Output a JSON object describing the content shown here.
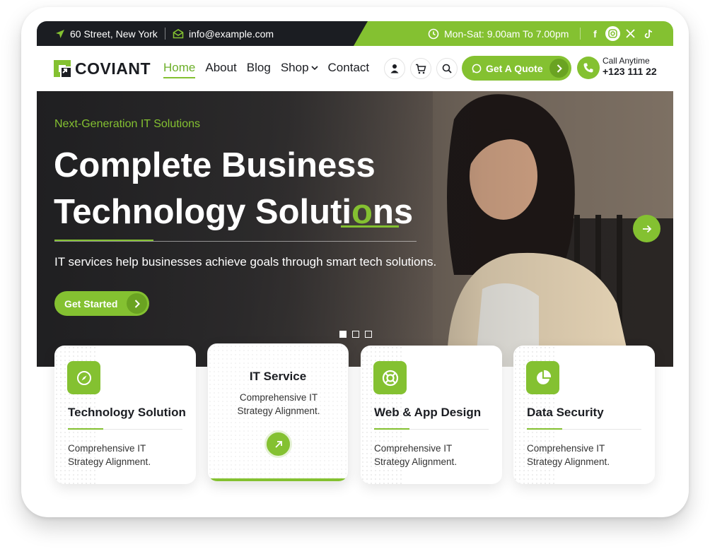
{
  "topbar": {
    "address": "60 Street, New York",
    "email": "info@example.com",
    "hours": "Mon-Sat: 9.00am To 7.00pm",
    "socials": [
      "facebook-icon",
      "instagram-icon",
      "x-icon",
      "tiktok-icon"
    ]
  },
  "header": {
    "logo_text": "COVIANT",
    "nav": [
      "Home",
      "About",
      "Blog",
      "Shop",
      "Contact"
    ],
    "quote_label": "Get A Quote",
    "call_label": "Call Anytime",
    "call_number": "+123 111 22"
  },
  "hero": {
    "eyebrow": "Next-Generation IT Solutions",
    "title_line1": "Complete Business",
    "title_line2_a": "Technology Solut",
    "title_line2_b": "i",
    "title_line2_c": "o",
    "title_line2_d": "ns",
    "description": "IT services help businesses achieve goals through smart tech solutions.",
    "button_label": "Get Started",
    "slides": 3,
    "active_slide": 1
  },
  "cards": [
    {
      "title": "Technology Solution",
      "desc": "Comprehensive IT Strategy Alignment.",
      "icon": "compass-icon"
    },
    {
      "title": "IT Service",
      "desc": "Comprehensive IT Strategy Alignment.",
      "icon": "arrow-up-right-icon"
    },
    {
      "title": "Web & App Design",
      "desc": "Comprehensive IT Strategy Alignment.",
      "icon": "lifebuoy-icon"
    },
    {
      "title": "Data Security",
      "desc": "Comprehensive IT Strategy Alignment.",
      "icon": "pie-chart-icon"
    }
  ],
  "colors": {
    "accent": "#84c131",
    "dark": "#1b1d22",
    "text": "#333333"
  }
}
